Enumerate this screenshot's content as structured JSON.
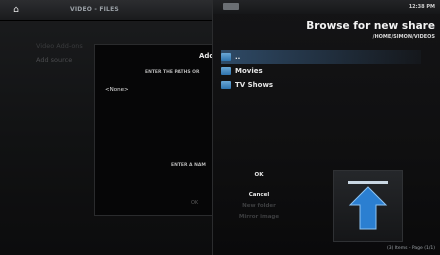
{
  "header": {
    "title": "VIDEO - FILES"
  },
  "background_list": {
    "items": [
      "Video Add-ons",
      "Add source"
    ]
  },
  "add_dialog": {
    "title": "Add",
    "enter_paths": "ENTER THE PATHS OR",
    "path_value": "<None>",
    "enter_name": "ENTER A NAM",
    "ok_label": "OK"
  },
  "browse": {
    "clock": "12:38 PM",
    "title": "Browse for new share",
    "path": "/HOME/SIMON/VIDEOS",
    "items": [
      {
        "label": "..",
        "icon": "folder-up-icon"
      },
      {
        "label": "Movies",
        "icon": "folder-icon"
      },
      {
        "label": "TV Shows",
        "icon": "folder-icon"
      }
    ],
    "buttons": {
      "ok": "OK",
      "cancel": "Cancel",
      "new_folder": "New folder",
      "mirror": "Mirror image"
    },
    "items_info": "(3) Items - Page (1/1)"
  },
  "colors": {
    "accent": "#2e73ad",
    "arrow": "#2b7fd1"
  }
}
